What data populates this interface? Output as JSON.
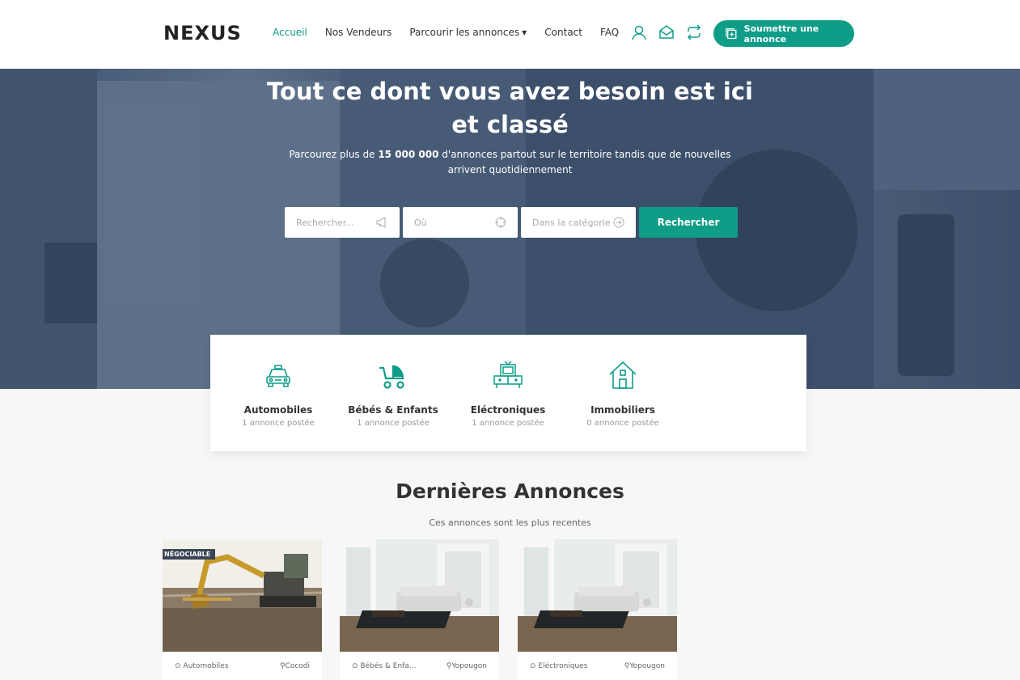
{
  "header": {
    "logo": "NEXUS",
    "nav": [
      {
        "label": "Accueil",
        "active": true
      },
      {
        "label": "Nos Vendeurs"
      },
      {
        "label": "Parcourir les annonces",
        "dropdown": true
      },
      {
        "label": "Contact"
      },
      {
        "label": "FAQ"
      }
    ],
    "icons": [
      "user-icon",
      "mail-icon",
      "exchange-icon"
    ],
    "submit_label": "Soumettre une annonce",
    "accent": "#0f9d88"
  },
  "hero": {
    "title_line1": "Tout ce dont vous avez besoin est ici",
    "title_line2": "et classé",
    "sub_prefix": "Parcourez plus de ",
    "sub_bold": "15 000 000",
    "sub_suffix": " d'annonces partout sur le territoire tandis que de nouvelles arrivent quotidiennement",
    "search": {
      "keyword_placeholder": "Rechercher...",
      "location_placeholder": "Où",
      "category_placeholder": "Dans la catégorie",
      "button": "Rechercher"
    }
  },
  "categories": [
    {
      "name": "Automobiles",
      "count": "1 annonce postée",
      "icon": "car-icon"
    },
    {
      "name": "Bébés & Enfants",
      "count": "1 annonce postée",
      "icon": "stroller-icon"
    },
    {
      "name": "Eléctroniques",
      "count": "1 annonce postée",
      "icon": "tv-icon"
    },
    {
      "name": "Immobiliers",
      "count": "0 annonce postée",
      "icon": "house-icon"
    }
  ],
  "latest": {
    "title": "Dernières Annonces",
    "subtitle": "Ces annonces sont les plus recentes",
    "cards": [
      {
        "badge": "NÉGOCIABLE",
        "category": "Automobiles",
        "location": "Cocodi",
        "image": "excavator"
      },
      {
        "badge": "",
        "category": "Bébés & Enfa...",
        "location": "Yopougon",
        "image": "living-room"
      },
      {
        "badge": "",
        "category": "Eléctroniques",
        "location": "Yopougon",
        "image": "living-room"
      }
    ]
  }
}
